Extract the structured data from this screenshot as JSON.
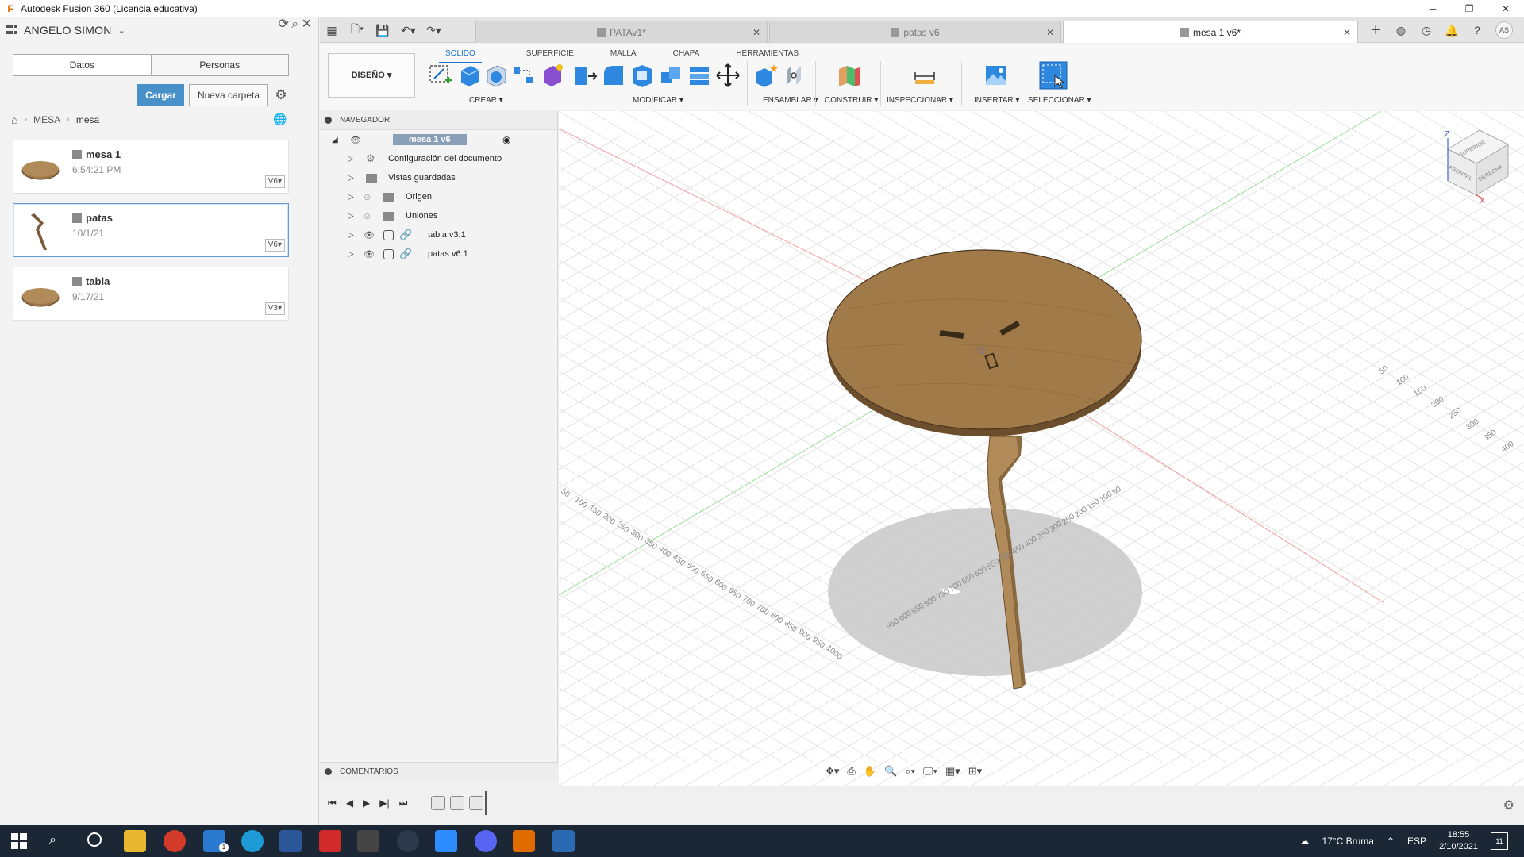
{
  "window": {
    "app_logo": "F",
    "title": "Autodesk Fusion 360 (Licencia educativa)",
    "minimize": "─",
    "maximize": "❐",
    "close": "✕"
  },
  "data_panel": {
    "user": "ANGELO SIMON",
    "tabs": [
      "Datos",
      "Personas"
    ],
    "upload_label": "Cargar",
    "new_folder_label": "Nueva carpeta",
    "breadcrumb": [
      "MESA",
      "mesa"
    ],
    "files": [
      {
        "name": "mesa 1",
        "date": "6:54:21 PM",
        "version": "V6▾"
      },
      {
        "name": "patas",
        "date": "10/1/21",
        "version": "V6▾"
      },
      {
        "name": "tabla",
        "date": "9/17/21",
        "version": "V3▾"
      }
    ]
  },
  "doc_tabs": [
    {
      "label": "PATAv1*",
      "active": false
    },
    {
      "label": "patas v6",
      "active": false
    },
    {
      "label": "mesa 1 v6*",
      "active": true
    }
  ],
  "user_initials": "AS",
  "ribbon": {
    "workspace_label": "DISEÑO ▾",
    "tabs": [
      "SOLIDO",
      "SUPERFICIE",
      "MALLA",
      "CHAPA",
      "HERRAMIENTAS"
    ],
    "groups": [
      "CREAR ▾",
      "MODIFICAR ▾",
      "ENSAMBLAR ▾",
      "CONSTRUIR ▾",
      "INSPECCIONAR ▾",
      "INSERTAR ▾",
      "SELECCIONAR ▾"
    ]
  },
  "navigator": {
    "title": "NAVEGADOR",
    "root": "mesa 1 v6",
    "items": [
      {
        "label": "Configuración del documento",
        "icon": "gear-icon"
      },
      {
        "label": "Vistas guardadas",
        "icon": "folder-icon"
      },
      {
        "label": "Origen",
        "icon": "folder-icon"
      },
      {
        "label": "Uniones",
        "icon": "folder-icon"
      },
      {
        "label": "tabla v3:1",
        "icon": "link-icon"
      },
      {
        "label": "patas v6:1",
        "icon": "link-icon"
      }
    ],
    "comments_title": "COMENTARIOS"
  },
  "viewcube": {
    "top": "SUPERIOR",
    "front": "FRONTAL",
    "right": "DERECHA",
    "axis_z": "Z",
    "axis_x": "X"
  },
  "grid_labels": {
    "left_axis": [
      "50",
      "100",
      "150",
      "200",
      "250",
      "300",
      "350",
      "400",
      "450",
      "500",
      "550",
      "600",
      "650",
      "700",
      "750",
      "800",
      "850",
      "900",
      "950",
      "1000"
    ],
    "right_axis": [
      "50",
      "100",
      "150",
      "200",
      "250",
      "300",
      "350",
      "400",
      "450",
      "500",
      "550",
      "600",
      "650",
      "700",
      "750",
      "800",
      "850",
      "900",
      "950"
    ],
    "top_right_axis": [
      "50",
      "100",
      "150",
      "200",
      "250",
      "300",
      "350",
      "400"
    ]
  },
  "taskbar": {
    "weather": "17°C Bruma",
    "language": "ESP",
    "time": "18:55",
    "date": "2/10/2021",
    "notifications": "11",
    "mail_badge": "1"
  },
  "colors": {
    "accent": "#1a73c8",
    "upload_button": "#4a90c8",
    "wood": "#9a7445",
    "taskbar": "#1c2735"
  }
}
